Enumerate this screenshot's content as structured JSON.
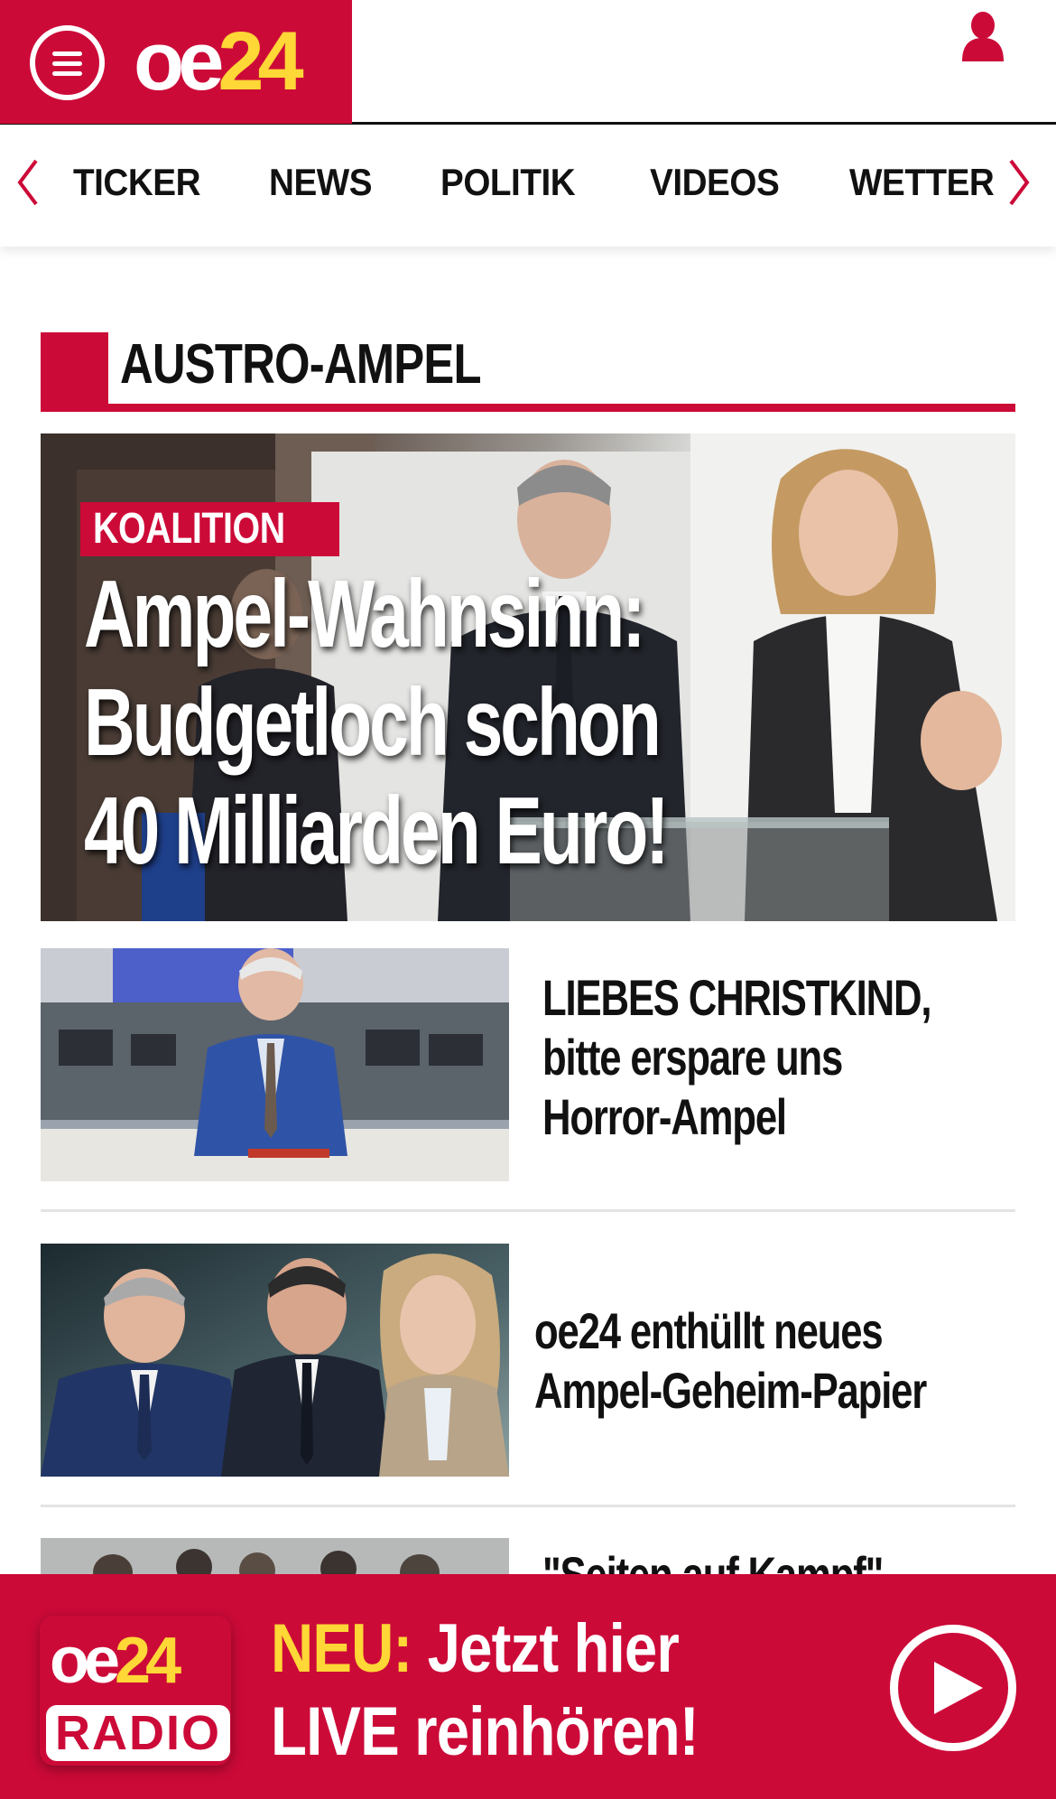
{
  "header": {
    "logo_main": "oe",
    "logo_num": "24",
    "menu_icon": "hamburger-menu-icon",
    "user_icon": "user-account-icon",
    "brand_color": "#cc0a38",
    "accent_color": "#ffd736"
  },
  "nav": {
    "items": [
      {
        "label": "TICKER"
      },
      {
        "label": "NEWS"
      },
      {
        "label": "POLITIK"
      },
      {
        "label": "VIDEOS"
      },
      {
        "label": "WETTER"
      }
    ],
    "prev_icon": "chevron-left-icon",
    "next_icon": "chevron-right-icon"
  },
  "section": {
    "title": "AUSTRO-AMPEL"
  },
  "hero": {
    "kicker": "KOALITION",
    "headline_line1": "Ampel-Wahnsinn:",
    "headline_line2": "Budgetloch schon",
    "headline_line3": "40 Milliarden Euro!"
  },
  "articles": [
    {
      "line1": "LIEBES CHRISTKIND,",
      "line2": "bitte erspare uns",
      "line3": "Horror-Ampel"
    },
    {
      "line1": "oe24 enthüllt neues",
      "line2": "Ampel-Geheim-Papier"
    },
    {
      "line1": "\"Seiten auf Kampf\" ..."
    }
  ],
  "radio": {
    "logo_main": "oe",
    "logo_num": "24",
    "logo_sub": "RADIO",
    "text_highlight": "NEU:",
    "text_line1_rest": " Jetzt hier",
    "text_line2": "LIVE reinhören!",
    "play_icon": "play-icon"
  }
}
